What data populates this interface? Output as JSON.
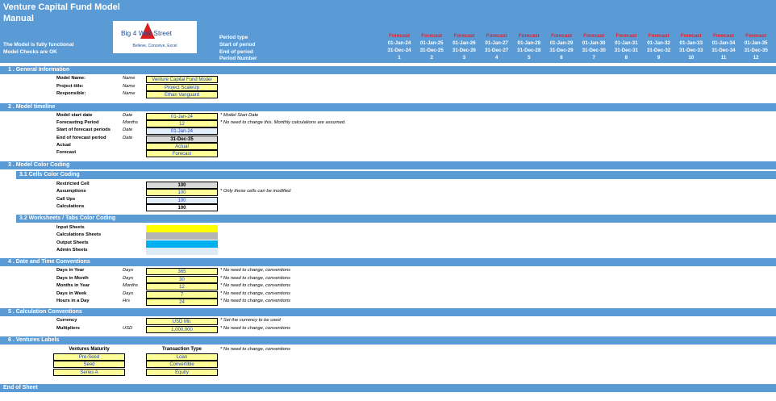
{
  "header": {
    "title_line1": "Venture Capital Fund Model",
    "title_line2": "Manual",
    "status1": "The Model is fully functional",
    "status2": "Model Checks are OK",
    "logo_text": "Big 4 Wall Street",
    "logo_tagline": "Believe, Conceive, Excel",
    "row_labels": [
      "Period type",
      "Start of period",
      "End of period",
      "Period Number"
    ],
    "periods": [
      {
        "type": "Forecast",
        "start": "01-Jan-24",
        "end": "31-Dec-24",
        "num": "1"
      },
      {
        "type": "Forecast",
        "start": "01-Jan-25",
        "end": "31-Dec-25",
        "num": "2"
      },
      {
        "type": "Forecast",
        "start": "01-Jan-26",
        "end": "31-Dec-26",
        "num": "3"
      },
      {
        "type": "Forecast",
        "start": "01-Jan-27",
        "end": "31-Dec-27",
        "num": "4"
      },
      {
        "type": "Forecast",
        "start": "01-Jan-28",
        "end": "31-Dec-28",
        "num": "5"
      },
      {
        "type": "Forecast",
        "start": "01-Jan-29",
        "end": "31-Dec-29",
        "num": "6"
      },
      {
        "type": "Forecast",
        "start": "01-Jan-30",
        "end": "31-Dec-30",
        "num": "7"
      },
      {
        "type": "Forecast",
        "start": "01-Jan-31",
        "end": "31-Dec-31",
        "num": "8"
      },
      {
        "type": "Forecast",
        "start": "01-Jan-32",
        "end": "31-Dec-32",
        "num": "9"
      },
      {
        "type": "Forecast",
        "start": "01-Jan-33",
        "end": "31-Dec-33",
        "num": "10"
      },
      {
        "type": "Forecast",
        "start": "01-Jan-34",
        "end": "31-Dec-34",
        "num": "11"
      },
      {
        "type": "Forecast",
        "start": "01-Jan-35",
        "end": "31-Dec-35",
        "num": "12"
      }
    ]
  },
  "sections": {
    "general": "1 . General Information",
    "timeline": "2 . Model timeline",
    "color": "3 . Model Color Coding",
    "cells_color": "3.1 Cells Color Coding",
    "tabs_color": "3.2 Worksheets / Tabs Color Coding",
    "datetime": "4 . Date and Time Conventions",
    "calc": "5 . Calculation Conventions",
    "ventures": "6 . Ventures Labels",
    "end": "End of Sheet"
  },
  "general": [
    {
      "label": "Model Name:",
      "unit": "Name",
      "value": "Venture Capital Fund Model"
    },
    {
      "label": "Project title:",
      "unit": "Name",
      "value": "Project ScaleUp"
    },
    {
      "label": "Responsible:",
      "unit": "Name",
      "value": "Ethan Vanguard"
    }
  ],
  "timeline": [
    {
      "label": "Model start date",
      "unit": "Date",
      "value": "01-Jan-24",
      "note": "* Model Start Date"
    },
    {
      "label": "Forecasting Period",
      "unit": "Months",
      "value": "12",
      "note": "* No need to change this. Monthly calculations are assumed."
    },
    {
      "label": "Start of forecast periods",
      "unit": "Date",
      "value": "01-Jan-24",
      "note": ""
    },
    {
      "label": "End of forecast period",
      "unit": "Date",
      "value": "31-Dec-35",
      "note": ""
    },
    {
      "label": "Actual",
      "unit": "",
      "value": "Actual",
      "note": ""
    },
    {
      "label": "Forecast",
      "unit": "",
      "value": "Forecast",
      "note": ""
    }
  ],
  "cells_color": [
    {
      "label": "Restricted Cell",
      "value": "100",
      "note": ""
    },
    {
      "label": "Assumptions",
      "value": "100",
      "note": "* Only these cells can be modified"
    },
    {
      "label": "Call Ups",
      "value": "100",
      "note": ""
    },
    {
      "label": "Calculations",
      "value": "100",
      "note": ""
    }
  ],
  "tabs_color": [
    {
      "label": "Input Sheets",
      "color": "#ffff00"
    },
    {
      "label": "Calculations Sheets",
      "color": "#b4b4b4"
    },
    {
      "label": "Output Sheets",
      "color": "#00b0f0"
    },
    {
      "label": "Admin Sheets",
      "color": "#ddebf7"
    }
  ],
  "datetime": [
    {
      "label": "Days in Year",
      "unit": "Days",
      "value": "365",
      "note": "* No need to change, conventions"
    },
    {
      "label": "Days in Month",
      "unit": "Days",
      "value": "30",
      "note": "* No need to change, conventions"
    },
    {
      "label": "Months in Year",
      "unit": "Months",
      "value": "12",
      "note": "* No need to change, conventions"
    },
    {
      "label": "Days in Week",
      "unit": "Days",
      "value": "7",
      "note": "* No need to change, conventions"
    },
    {
      "label": "Hours in a Day",
      "unit": "Hrs",
      "value": "24",
      "note": "* No need to change, conventions"
    }
  ],
  "calc": [
    {
      "label": "Currency",
      "unit": "",
      "value": "USD Mil.",
      "note": "* Set the currency to be used"
    },
    {
      "label": "Multipliers",
      "unit": "USD",
      "value": "1,000,000",
      "note": "* No need to change, conventions"
    }
  ],
  "ventures": {
    "maturity_header": "Ventures Maturity",
    "transaction_header": "Transaction Type",
    "note": "* No need to change, conventions",
    "maturity": [
      "Pre-Seed",
      "Seed",
      "Series A"
    ],
    "transaction": [
      "Loan",
      "Convertible",
      "Equity"
    ]
  }
}
